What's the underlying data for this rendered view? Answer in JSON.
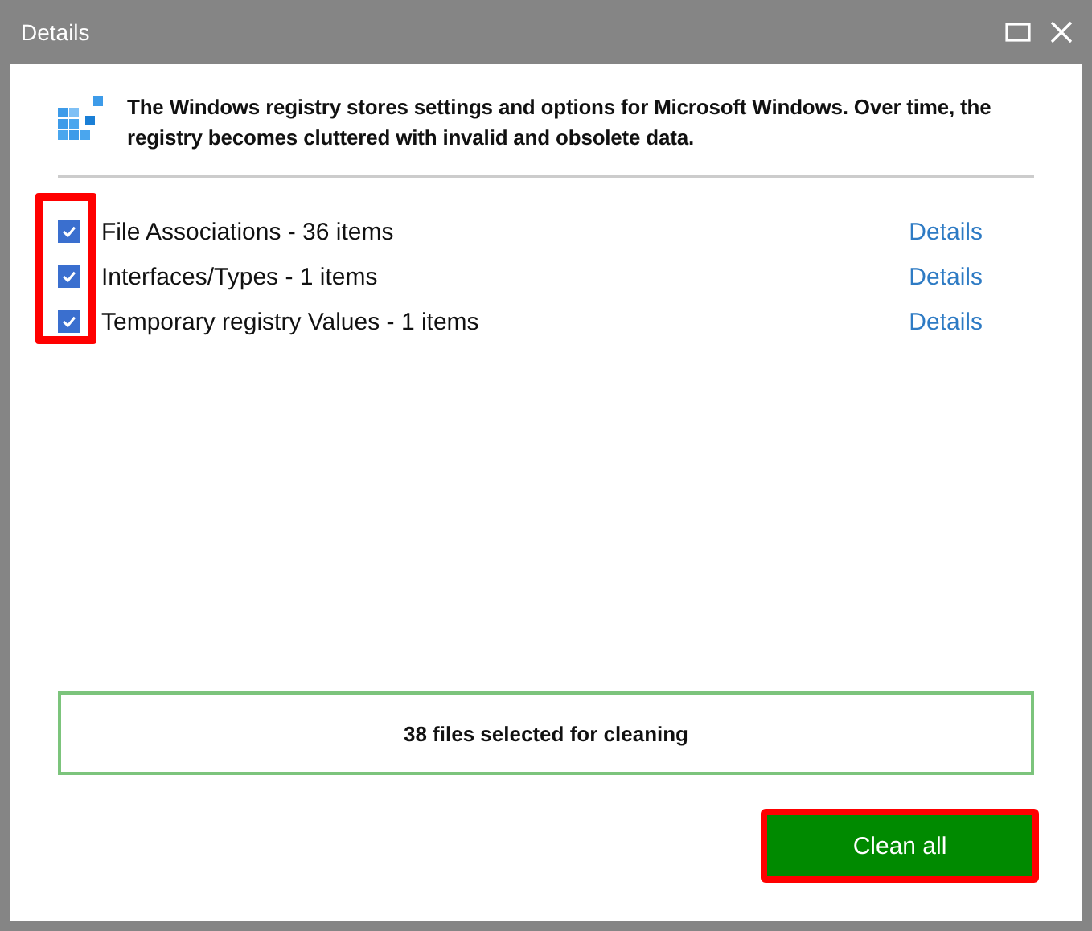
{
  "window": {
    "title": "Details"
  },
  "intro": "The Windows registry stores settings and options for Microsoft Windows. Over time, the registry becomes cluttered with invalid and obsolete data.",
  "items": [
    {
      "label": "File Associations - 36 items",
      "checked": true,
      "link": "Details"
    },
    {
      "label": "Interfaces/Types - 1 items",
      "checked": true,
      "link": "Details"
    },
    {
      "label": "Temporary registry Values - 1 items",
      "checked": true,
      "link": "Details"
    }
  ],
  "status": "38 files selected for cleaning",
  "button": "Clean all"
}
